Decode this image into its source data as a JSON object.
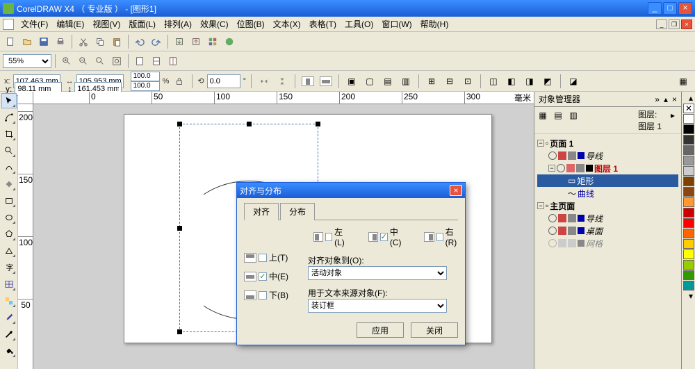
{
  "titlebar": {
    "app": "CorelDRAW X4 （ 专业版 ） - [图形1]"
  },
  "menus": [
    "文件(F)",
    "编辑(E)",
    "视图(V)",
    "版面(L)",
    "排列(A)",
    "效果(C)",
    "位图(B)",
    "文本(X)",
    "表格(T)",
    "工具(O)",
    "窗口(W)",
    "帮助(H)"
  ],
  "zoom": "55%",
  "props": {
    "x": "107.463 mm",
    "y": "98.11 mm",
    "w": "105.953 mm",
    "h": "161.453 mm",
    "sx": "100.0",
    "sy": "100.0",
    "rot": "0.0"
  },
  "ruler_h": [
    "0",
    "50",
    "100",
    "150",
    "200",
    "250",
    "300"
  ],
  "ruler_h_end": "毫米",
  "ruler_v": [
    "200",
    "150",
    "100",
    "50"
  ],
  "docker": {
    "title": "对象管理器",
    "layer_lbl": "图层:",
    "layer_name": "图层 1",
    "tree": {
      "page": "页面 1",
      "guide": "导线",
      "layer": "图层  1",
      "rect": "矩形",
      "curve": "曲线",
      "master": "主页面",
      "mguide": "导线",
      "desktop": "桌面",
      "grid": "网格"
    }
  },
  "dialog": {
    "title": "对齐与分布",
    "tab_align": "对齐",
    "tab_dist": "分布",
    "left": "左(L)",
    "hcenter": "中(C)",
    "right": "右(R)",
    "top": "上(T)",
    "vcenter": "中(E)",
    "bottom": "下(B)",
    "alignto": "对齐对象到(O):",
    "alignto_val": "活动对象",
    "textsrc": "用于文本来源对象(F):",
    "textsrc_val": "装订框",
    "apply": "应用",
    "close": "关闭"
  },
  "palette": [
    "#ffffff",
    "#000000",
    "#333333",
    "#666666",
    "#999999",
    "#cccccc",
    "#804000",
    "#8b4513",
    "#ff9933",
    "#cc0000",
    "#ff0000",
    "#ff6600",
    "#ffcc00",
    "#ffff00",
    "#99cc00",
    "#339900",
    "#009999"
  ]
}
